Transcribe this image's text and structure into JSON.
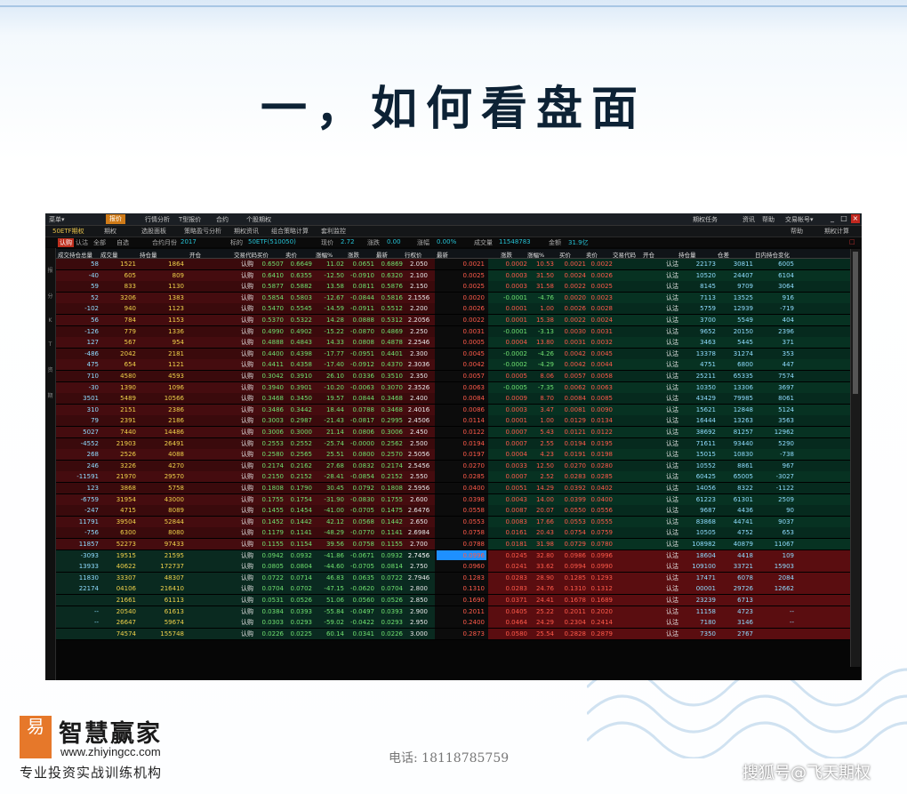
{
  "slide": {
    "title": "一，如何看盘面",
    "logo_mark": "易",
    "logo_text": "智慧赢家",
    "logo_url": "www.zhiyingcc.com",
    "logo_tagline": "专业投资实战训练机构",
    "phone": "电话: 18118785759",
    "watermark": "搜狐号@飞天期权"
  },
  "window": {
    "menu": [
      "菜单▾",
      "报价",
      "行情分析",
      "T型报价",
      "合约",
      "个股期权"
    ],
    "title_right": [
      "期权任务",
      "资讯",
      "帮助",
      "交易帐号▾"
    ],
    "window_buttons": [
      "_",
      "□",
      "×"
    ],
    "tabs": [
      "50ETF期权",
      "期权",
      "选股面板",
      "策略盈亏分析",
      "期权资讯",
      "组合策略计算",
      "套利监控"
    ],
    "tab_right": [
      "帮助",
      "期权计算"
    ],
    "filter_tabs": [
      "认购",
      "认沽",
      "全部",
      "自选"
    ],
    "filter_info": [
      {
        "label": "合约月份",
        "value": "2017"
      },
      {
        "label": "标的",
        "value": "50ETF(510050)"
      },
      {
        "label": "现价",
        "value": "2.72"
      },
      {
        "label": "涨跌",
        "value": "0.00"
      },
      {
        "label": "涨幅",
        "value": "0.00%"
      },
      {
        "label": "成交量",
        "value": "11548783"
      },
      {
        "label": "金额",
        "value": "31.9亿"
      }
    ],
    "scroll_indicator": "□"
  },
  "sidebar": [
    "报",
    "分",
    "K",
    "T",
    "资",
    "期"
  ],
  "table": {
    "headers": [
      "成交持仓总量",
      "成交量",
      "持仓量",
      "开仓",
      "交易代码",
      "买价",
      "卖价",
      "涨幅%",
      "涨跌",
      "最新",
      "行权价",
      "最新",
      "涨跌",
      "涨幅%",
      "买价",
      "卖价",
      "交易代码",
      "开仓",
      "持仓量",
      "仓差",
      "日内持仓变化"
    ],
    "rows": [
      [
        "58",
        "1521",
        "1864",
        "",
        "认购",
        "0.6507",
        "0.6649",
        "11.02",
        "0.0651",
        "0.6869",
        "2.050",
        "0.0021",
        "0.0002",
        "10.53",
        "0.0021",
        "0.0022",
        "",
        "认沽",
        "22173",
        "30811",
        "6005"
      ],
      [
        "-40",
        "605",
        "809",
        "",
        "认购",
        "0.6410",
        "0.6355",
        "-12.50",
        "-0.0910",
        "0.6320",
        "2.100",
        "0.0025",
        "0.0003",
        "31.50",
        "0.0024",
        "0.0026",
        "",
        "认沽",
        "10520",
        "24407",
        "6104"
      ],
      [
        "59",
        "833",
        "1130",
        "",
        "认购",
        "0.5877",
        "0.5882",
        "13.58",
        "0.0811",
        "0.5876",
        "2.150",
        "0.0025",
        "0.0003",
        "31.58",
        "0.0022",
        "0.0025",
        "",
        "认沽",
        "8145",
        "9709",
        "3064"
      ],
      [
        "52",
        "3206",
        "1383",
        "",
        "认购",
        "0.5854",
        "0.5803",
        "-12.67",
        "-0.0844",
        "0.5816",
        "2.1556",
        "0.0020",
        "-0.0001",
        "-4.76",
        "0.0020",
        "0.0023",
        "",
        "认沽",
        "7113",
        "13525",
        "916"
      ],
      [
        "-102",
        "940",
        "1123",
        "",
        "认购",
        "0.5470",
        "0.5545",
        "-14.59",
        "-0.0911",
        "0.5512",
        "2.200",
        "0.0026",
        "0.0001",
        "1.00",
        "0.0026",
        "0.0028",
        "",
        "认沽",
        "5759",
        "12939",
        "-719"
      ],
      [
        "56",
        "784",
        "1153",
        "",
        "认购",
        "0.5370",
        "0.5322",
        "14.28",
        "0.0888",
        "0.5312",
        "2.2056",
        "0.0022",
        "0.0001",
        "15.38",
        "0.0022",
        "0.0024",
        "",
        "认沽",
        "3700",
        "5549",
        "404"
      ],
      [
        "-126",
        "779",
        "1336",
        "",
        "认购",
        "0.4990",
        "0.4902",
        "-15.22",
        "-0.0870",
        "0.4869",
        "2.250",
        "0.0031",
        "-0.0001",
        "-3.13",
        "0.0030",
        "0.0031",
        "",
        "认沽",
        "9652",
        "20150",
        "2396"
      ],
      [
        "127",
        "567",
        "954",
        "",
        "认购",
        "0.4888",
        "0.4843",
        "14.33",
        "0.0808",
        "0.4878",
        "2.2546",
        "0.0005",
        "0.0004",
        "13.80",
        "0.0031",
        "0.0032",
        "",
        "认沽",
        "3463",
        "5445",
        "371"
      ],
      [
        "-486",
        "2042",
        "2181",
        "",
        "认购",
        "0.4400",
        "0.4398",
        "-17.77",
        "-0.0951",
        "0.4401",
        "2.300",
        "0.0045",
        "-0.0002",
        "-4.26",
        "0.0042",
        "0.0045",
        "",
        "认沽",
        "13378",
        "31274",
        "353"
      ],
      [
        "475",
        "654",
        "1121",
        "",
        "认购",
        "0.4411",
        "0.4358",
        "-17.40",
        "-0.0912",
        "0.4370",
        "2.3036",
        "0.0042",
        "-0.0002",
        "-4.29",
        "0.0042",
        "0.0044",
        "",
        "认沽",
        "4751",
        "6800",
        "447"
      ],
      [
        "710",
        "4580",
        "4593",
        "",
        "认购",
        "0.3042",
        "0.3910",
        "26.10",
        "0.0336",
        "0.3510",
        "2.350",
        "0.0057",
        "0.0005",
        "8.06",
        "0.0057",
        "0.0058",
        "",
        "认沽",
        "25211",
        "65335",
        "7574"
      ],
      [
        "-30",
        "1390",
        "1096",
        "",
        "认购",
        "0.3940",
        "0.3901",
        "-10.20",
        "-0.0063",
        "0.3070",
        "2.3526",
        "0.0063",
        "-0.0005",
        "-7.35",
        "0.0062",
        "0.0063",
        "",
        "认沽",
        "10350",
        "13306",
        "3697"
      ],
      [
        "3501",
        "5489",
        "10566",
        "",
        "认购",
        "0.3468",
        "0.3450",
        "19.57",
        "0.0844",
        "0.3468",
        "2.400",
        "0.0084",
        "0.0009",
        "8.70",
        "0.0084",
        "0.0085",
        "",
        "认沽",
        "43429",
        "79985",
        "8061"
      ],
      [
        "310",
        "2151",
        "2386",
        "",
        "认购",
        "0.3486",
        "0.3442",
        "18.44",
        "0.0788",
        "0.3468",
        "2.4016",
        "0.0086",
        "0.0003",
        "3.47",
        "0.0081",
        "0.0090",
        "",
        "认沽",
        "15621",
        "12848",
        "5124"
      ],
      [
        "79",
        "2391",
        "2186",
        "",
        "认购",
        "0.3003",
        "0.2987",
        "-21.43",
        "-0.0817",
        "0.2995",
        "2.4506",
        "0.0114",
        "0.0001",
        "1.00",
        "0.0129",
        "0.0134",
        "",
        "认沽",
        "16444",
        "13263",
        "3563"
      ],
      [
        "5027",
        "7440",
        "14486",
        "",
        "认购",
        "0.3006",
        "0.3000",
        "21.14",
        "0.0806",
        "0.3006",
        "2.450",
        "0.0122",
        "0.0007",
        "5.43",
        "0.0121",
        "0.0122",
        "",
        "认沽",
        "38692",
        "81257",
        "12962"
      ],
      [
        "-4552",
        "21903",
        "26491",
        "",
        "认购",
        "0.2553",
        "0.2552",
        "-25.74",
        "-0.0000",
        "0.2562",
        "2.500",
        "0.0194",
        "0.0007",
        "2.55",
        "0.0194",
        "0.0195",
        "",
        "认沽",
        "71611",
        "93440",
        "5290"
      ],
      [
        "268",
        "2526",
        "4088",
        "",
        "认购",
        "0.2580",
        "0.2565",
        "25.51",
        "0.0800",
        "0.2570",
        "2.5056",
        "0.0197",
        "0.0004",
        "4.23",
        "0.0191",
        "0.0198",
        "",
        "认沽",
        "15015",
        "10830",
        "-738"
      ],
      [
        "246",
        "3226",
        "4270",
        "",
        "认购",
        "0.2174",
        "0.2162",
        "27.68",
        "0.0832",
        "0.2174",
        "2.5456",
        "0.0270",
        "0.0033",
        "12.50",
        "0.0270",
        "0.0280",
        "",
        "认沽",
        "10552",
        "8861",
        "967"
      ],
      [
        "-11591",
        "21970",
        "29570",
        "",
        "认购",
        "0.2150",
        "0.2152",
        "-28.41",
        "-0.0854",
        "0.2152",
        "2.550",
        "0.0285",
        "0.0007",
        "2.52",
        "0.0283",
        "0.0285",
        "",
        "认沽",
        "60425",
        "65005",
        "-3027"
      ],
      [
        "123",
        "3868",
        "5758",
        "",
        "认购",
        "0.1808",
        "0.1790",
        "30.45",
        "0.0792",
        "0.1808",
        "2.5956",
        "0.0400",
        "0.0051",
        "14.29",
        "0.0392",
        "0.0402",
        "",
        "认沽",
        "14056",
        "8322",
        "-1122"
      ],
      [
        "-6759",
        "31954",
        "43000",
        "",
        "认购",
        "0.1755",
        "0.1754",
        "-31.90",
        "-0.0830",
        "0.1755",
        "2.600",
        "0.0398",
        "0.0043",
        "14.00",
        "0.0399",
        "0.0400",
        "",
        "认沽",
        "61223",
        "61301",
        "2509"
      ],
      [
        "-247",
        "4715",
        "8089",
        "",
        "认购",
        "0.1455",
        "0.1454",
        "-41.00",
        "-0.0705",
        "0.1475",
        "2.6476",
        "0.0558",
        "0.0087",
        "20.07",
        "0.0550",
        "0.0556",
        "",
        "认沽",
        "9687",
        "4436",
        "90"
      ],
      [
        "11791",
        "39504",
        "52844",
        "",
        "认购",
        "0.1452",
        "0.1442",
        "42.12",
        "0.0568",
        "0.1442",
        "2.650",
        "0.0553",
        "0.0083",
        "17.66",
        "0.0553",
        "0.0555",
        "",
        "认沽",
        "83868",
        "44741",
        "9037"
      ],
      [
        "-756",
        "6300",
        "8080",
        "",
        "认购",
        "0.1179",
        "0.1141",
        "-48.29",
        "-0.0770",
        "0.1141",
        "2.6984",
        "0.0758",
        "0.0161",
        "20.43",
        "0.0754",
        "0.0759",
        "",
        "认沽",
        "10505",
        "4752",
        "653"
      ],
      [
        "11857",
        "52273",
        "97433",
        "",
        "认购",
        "0.1155",
        "0.1154",
        "39.56",
        "0.0758",
        "0.1155",
        "2.700",
        "0.0788",
        "0.0181",
        "31.98",
        "0.0729",
        "0.0780",
        "",
        "认沽",
        "108982",
        "40879",
        "11067"
      ],
      [
        "-3093",
        "19515",
        "21595",
        "",
        "认购",
        "0.0942",
        "0.0932",
        "-41.86",
        "-0.0671",
        "0.0932",
        "2.7456",
        "0.0996",
        "0.0245",
        "32.80",
        "0.0986",
        "0.0996",
        "",
        "认沽",
        "18604",
        "4418",
        "109"
      ],
      [
        "13933",
        "40622",
        "172737",
        "",
        "认购",
        "0.0805",
        "0.0804",
        "-44.60",
        "-0.0705",
        "0.0814",
        "2.750",
        "0.0960",
        "0.0241",
        "33.62",
        "0.0994",
        "0.0990",
        "",
        "认沽",
        "109100",
        "33721",
        "15903"
      ],
      [
        "11830",
        "33307",
        "48307",
        "",
        "认购",
        "0.0722",
        "0.0714",
        "46.83",
        "0.0635",
        "0.0722",
        "2.7946",
        "0.1283",
        "0.0283",
        "28.90",
        "0.1285",
        "0.1293",
        "",
        "认沽",
        "17471",
        "6078",
        "2084"
      ],
      [
        "22174",
        "04106",
        "216410",
        "",
        "认购",
        "0.0704",
        "0.0702",
        "-47.15",
        "-0.0620",
        "0.0704",
        "2.800",
        "0.1310",
        "0.0283",
        "24.76",
        "0.1310",
        "0.1312",
        "",
        "认沽",
        "00001",
        "29726",
        "12662"
      ],
      [
        "",
        "21661",
        "61113",
        "",
        "认购",
        "0.0531",
        "0.0526",
        "51.06",
        "0.0560",
        "0.0526",
        "2.850",
        "0.1690",
        "0.0371",
        "24.41",
        "0.1678",
        "0.1689",
        "",
        "认沽",
        "23239",
        "6713",
        ""
      ],
      [
        "--",
        "20540",
        "61613",
        "",
        "认购",
        "0.0384",
        "0.0393",
        "-55.84",
        "-0.0497",
        "0.0393",
        "2.900",
        "0.2011",
        "0.0405",
        "25.22",
        "0.2011",
        "0.2020",
        "",
        "认沽",
        "11158",
        "4723",
        "--"
      ],
      [
        "--",
        "26647",
        "59674",
        "",
        "认购",
        "0.0303",
        "0.0293",
        "-59.02",
        "-0.0422",
        "0.0293",
        "2.950",
        "0.2400",
        "0.0464",
        "24.29",
        "0.2304",
        "0.2414",
        "",
        "认沽",
        "7180",
        "3146",
        "--"
      ],
      [
        "",
        "74574",
        "155748",
        "",
        "认购",
        "0.0226",
        "0.0225",
        "60.14",
        "0.0341",
        "0.0226",
        "3.000",
        "0.2873",
        "0.0580",
        "25.54",
        "0.2828",
        "0.2879",
        "",
        "认沽",
        "7350",
        "2767",
        ""
      ]
    ],
    "highlight_row": 26
  },
  "colors": {
    "call_bg": "#3a0a0c",
    "call_bg_alt": "#450c0f",
    "put_bg": "#062a1e",
    "put_bg_alt": "#073222",
    "call_bg_itm": "#0a2a20",
    "put_bg_itm": "#5a0d10",
    "strike_bg": "#0c0c0c",
    "highlight": "#1e90ff"
  }
}
